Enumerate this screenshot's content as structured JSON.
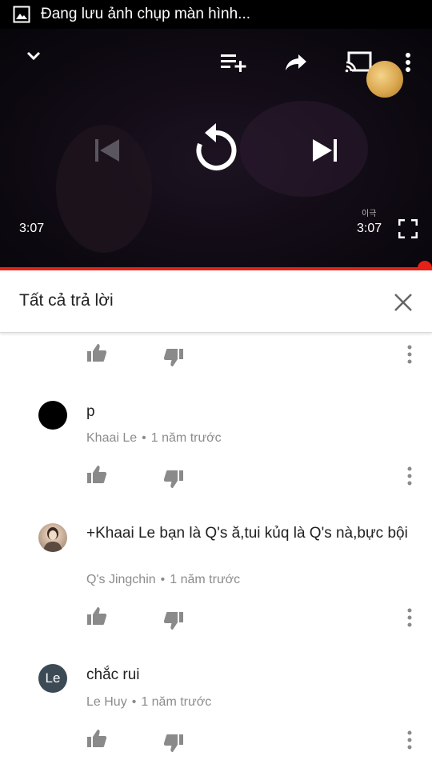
{
  "status_bar": {
    "text": "Đang lưu ảnh chụp màn hình..."
  },
  "player": {
    "current_time": "3:07",
    "duration": "3:07",
    "progress_fraction": 1.0,
    "watermark_text": "이극"
  },
  "panel": {
    "title": "Tất cả trả lời"
  },
  "comments": [
    {
      "text": "p",
      "author": "Khaai Le",
      "separator": "•",
      "time": "1 năm trước"
    },
    {
      "text": "+Khaai Le  bạn là Q's ă,tui kủq là Q's nà,bực bội",
      "author": "Q's Jingchin",
      "separator": "•",
      "time": "1 năm trước"
    },
    {
      "text": "chắc rui",
      "author": "Le Huy",
      "separator": "•",
      "time": "1 năm trước",
      "avatar_initials": "Le"
    }
  ],
  "colors": {
    "accent": "#e62117",
    "meta": "#8c8c8c",
    "avatar_le": "#3b4a54"
  }
}
